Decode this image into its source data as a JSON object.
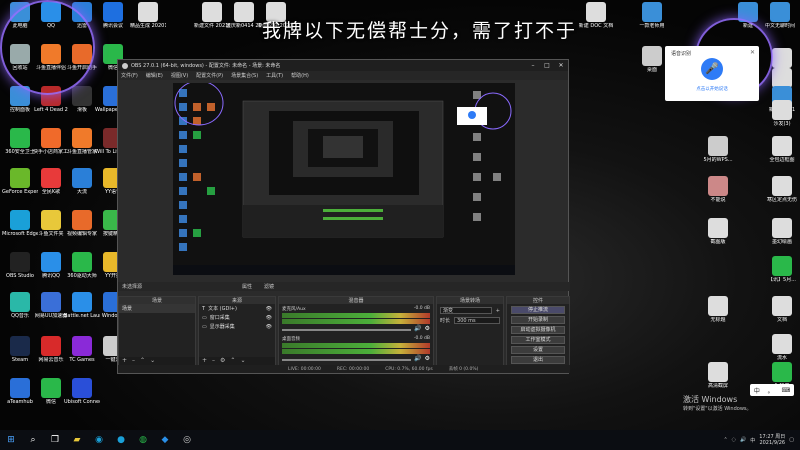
{
  "overlay_text": "我牌以下无偿帮士分，需了打不于",
  "desktop_icons_left": [
    {
      "label": "此电脑",
      "color": "#3a8fd8"
    },
    {
      "label": "QQ",
      "color": "#2a8fe8"
    },
    {
      "label": "迅雷",
      "color": "#2a7fd8"
    },
    {
      "label": "腾讯会议",
      "color": "#1e6fe0"
    },
    {
      "label": "回收站",
      "color": "#9aa"
    },
    {
      "label": "斗鱼直播伴侣",
      "color": "#f07a2a"
    },
    {
      "label": "斗鱼开启助手",
      "color": "#e86a2a"
    },
    {
      "label": "微信",
      "color": "#2ab84a"
    },
    {
      "label": "控制面板",
      "color": "#3a8fd8"
    },
    {
      "label": "Left 4 Dead 2",
      "color": "#b82a2a"
    },
    {
      "label": "滑板",
      "color": "#333"
    },
    {
      "label": "Wallpaper Engine",
      "color": "#2a6fd8"
    },
    {
      "label": "360安全卫士",
      "color": "#2ab84a"
    },
    {
      "label": "快手小店商家工作台",
      "color": "#f06a2a"
    },
    {
      "label": "斗鱼直播管家",
      "color": "#f07a2a"
    },
    {
      "label": "Will To Live Online",
      "color": "#7a2a2a"
    },
    {
      "label": "GeForce Experience",
      "color": "#6ab82a"
    },
    {
      "label": "全民K歌",
      "color": "#e83a3a"
    },
    {
      "label": "大流",
      "color": "#2a7fd8"
    },
    {
      "label": "YY语音",
      "color": "#e8b82a"
    },
    {
      "label": "Microsoft Edge",
      "color": "#1aa0d8"
    },
    {
      "label": "斗鱼文件夹",
      "color": "#e8c83a"
    },
    {
      "label": "视频编辑专家",
      "color": "#e86a2a"
    },
    {
      "label": "按键精灵",
      "color": "#3ab84a"
    },
    {
      "label": "OBS Studio",
      "color": "#222"
    },
    {
      "label": "腾讯QQ",
      "color": "#2a8fe8"
    },
    {
      "label": "360驱动大师",
      "color": "#2ab84a"
    },
    {
      "label": "YY开播",
      "color": "#e8b82a"
    },
    {
      "label": "QQ音乐",
      "color": "#2ab8a8"
    },
    {
      "label": "网易UU加速器",
      "color": "#3a6fd8"
    },
    {
      "label": "Battle.net Launcher",
      "color": "#2a8fe8"
    },
    {
      "label": "Windows",
      "color": "#2a6fd8"
    },
    {
      "label": "Steam",
      "color": "#1a2a4a"
    },
    {
      "label": "网易云音乐",
      "color": "#d82a2a"
    },
    {
      "label": "TC Games",
      "color": "#8a2ad8"
    },
    {
      "label": "一键开",
      "color": "#ccc"
    },
    {
      "label": "aTeamhub",
      "color": "#2a6fd8"
    },
    {
      "label": "微信",
      "color": "#2ab84a"
    },
    {
      "label": "Ubisoft Connect",
      "color": "#2a4fd8"
    }
  ],
  "desktop_icons_top": [
    {
      "label": "精品生成 20201(1)",
      "color": "#ddd"
    },
    {
      "label": "新建文件 20210727",
      "color": "#ddd"
    },
    {
      "label": "重庆新0414 20210825",
      "color": "#ddd"
    },
    {
      "label": "新建文件 2020102",
      "color": "#ddd"
    },
    {
      "label": "新建 DOC 文档",
      "color": "#ddd"
    },
    {
      "label": "一款老师用",
      "color": "#3a8fd8"
    },
    {
      "label": "新建",
      "color": "#3a8fd8"
    },
    {
      "label": "中文无聊时间",
      "color": "#3a8fd8"
    }
  ],
  "desktop_icons_right": [
    {
      "label": "桌面",
      "color": "#ccc"
    },
    {
      "label": "新建",
      "color": "#ddd"
    },
    {
      "label": "无敌",
      "color": "#ddd"
    },
    {
      "label": "新建文件11",
      "color": "#3a8fd8"
    },
    {
      "label": "沙发(3)",
      "color": "#ddd"
    },
    {
      "label": "5月的WPS...",
      "color": "#ccc"
    },
    {
      "label": "全包边框图",
      "color": "#ddd"
    },
    {
      "label": "不能说",
      "color": "#c88"
    },
    {
      "label": "寒区定点无伤",
      "color": "#ddd"
    },
    {
      "label": "截图版",
      "color": "#ddd"
    },
    {
      "label": "墨幻绘画",
      "color": "#ddd"
    },
    {
      "label": "【讯】5月...",
      "color": "#2ab84a"
    },
    {
      "label": "无标题",
      "color": "#ddd"
    },
    {
      "label": "文档",
      "color": "#ddd"
    },
    {
      "label": "流水",
      "color": "#ddd"
    },
    {
      "label": "高清截屏",
      "color": "#ddd"
    },
    {
      "label": "1-抖音",
      "color": "#2ab84a"
    }
  ],
  "obs": {
    "title": "OBS 27.0.1 (64-bit, windows) - 配置文件: 未命名 - 场景: 未命名",
    "menu": [
      "文件(F)",
      "编辑(E)",
      "视图(V)",
      "配置文件(P)",
      "场景集合(S)",
      "工具(T)",
      "帮助(H)"
    ],
    "scene_bar_left": "未选择源",
    "scene_bar_mid": "属性",
    "scene_bar_right": "滤镜",
    "panels": {
      "scenes": {
        "title": "场景",
        "items": [
          "场景"
        ]
      },
      "sources": {
        "title": "来源",
        "items": [
          "文本 (GDI+)",
          "窗口采集",
          "显示器采集"
        ]
      },
      "mixer": {
        "title": "混音器",
        "tracks": [
          {
            "name": "麦克风/Aux",
            "level": "-0.0 dB"
          },
          {
            "name": "桌面音频",
            "level": "-0.0 dB"
          }
        ]
      },
      "transitions": {
        "title": "场景转场",
        "type": "渐变",
        "duration_label": "时长",
        "duration": "300 ms"
      },
      "controls": {
        "title": "控件",
        "buttons": [
          "停止推流",
          "开始录制",
          "启动虚拟摄像机",
          "工作室模式",
          "设置",
          "退出"
        ]
      }
    },
    "status": {
      "live": "LIVE: 00:00:00",
      "rec": "REC: 00:00:00",
      "cpu": "CPU: 0.7%, 60.00 fps",
      "drops": "丢帧 0 (0.0%)"
    }
  },
  "voice_widget": {
    "title": "语音识别",
    "status": "点击以开始说话"
  },
  "activate": {
    "line1": "激活 Windows",
    "line2": "转到\"设置\"以激活 Windows。"
  },
  "ime": {
    "lang": "中",
    "punct": "。"
  },
  "clock": {
    "time": "17:27 周日",
    "date": "2021/9/26"
  }
}
